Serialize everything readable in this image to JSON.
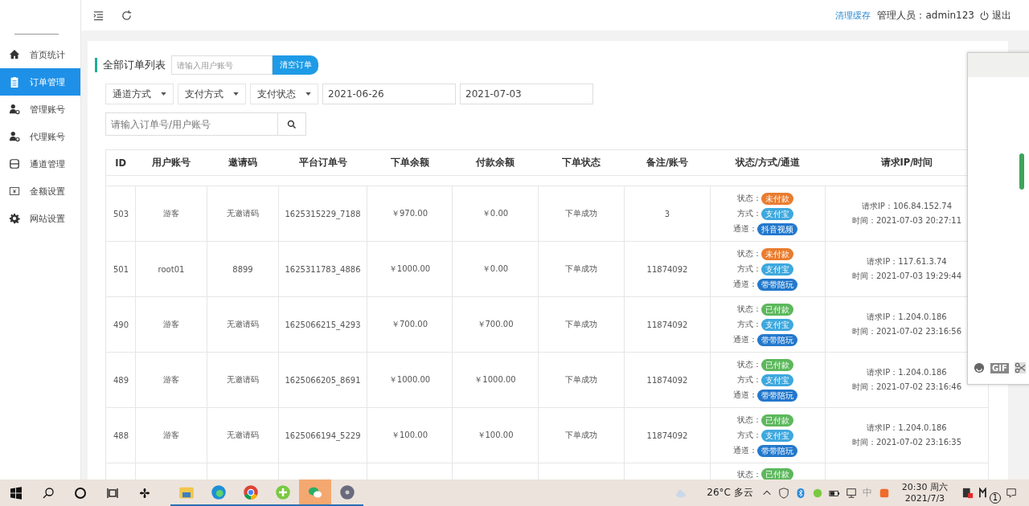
{
  "header": {
    "clear_cache": "清理缓存",
    "admin_label": "管理人员：admin123",
    "logout": "退出"
  },
  "sidebar": {
    "items": [
      {
        "label": "首页统计",
        "selected": false
      },
      {
        "label": "订单管理",
        "selected": true
      },
      {
        "label": "管理账号",
        "selected": false
      },
      {
        "label": "代理账号",
        "selected": false
      },
      {
        "label": "通道管理",
        "selected": false
      },
      {
        "label": "金额设置",
        "selected": false
      },
      {
        "label": "网站设置",
        "selected": false
      }
    ]
  },
  "panel": {
    "title": "全部订单列表",
    "user_search": {
      "placeholder": "请输入用户账号"
    },
    "clear_button": "清空订单",
    "filters": [
      {
        "label": "通道方式"
      },
      {
        "label": "支付方式"
      },
      {
        "label": "支付状态"
      }
    ],
    "date_from": "2021-06-26",
    "date_to": "2021-07-03",
    "search": {
      "placeholder": "请输入订单号/用户账号"
    }
  },
  "table": {
    "columns": [
      "ID",
      "用户账号",
      "邀请码",
      "平台订单号",
      "下单余额",
      "付款余额",
      "下单状态",
      "备注/账号",
      "状态/方式/通道",
      "请求IP/时间"
    ],
    "rows": [
      {
        "cells": [
          "503",
          "游客",
          "无邀请码",
          "1625315229_7188",
          "￥970.00",
          "￥0.00",
          "下单成功",
          "3"
        ],
        "status_label": "状态：",
        "status": {
          "kind": "unpaid",
          "text": "未付款"
        },
        "method_label": "方式：",
        "method": "支付宝",
        "channel_label": "通道：",
        "channel": "抖音视频",
        "ip": "请求IP：106.84.152.74",
        "time": "时间：2021-07-03 20:27:11"
      },
      {
        "cells": [
          "501",
          "root01",
          "8899",
          "1625311783_4886",
          "￥1000.00",
          "￥0.00",
          "下单成功",
          "11874092"
        ],
        "status_label": "状态：",
        "status": {
          "kind": "unpaid",
          "text": "未付款"
        },
        "method_label": "方式：",
        "method": "支付宝",
        "channel_label": "通道：",
        "channel": "带带陪玩",
        "ip": "请求IP：117.61.3.74",
        "time": "时间：2021-07-03 19:29:44"
      },
      {
        "cells": [
          "490",
          "游客",
          "无邀请码",
          "1625066215_4293",
          "￥700.00",
          "￥700.00",
          "下单成功",
          "11874092"
        ],
        "status_label": "状态：",
        "status": {
          "kind": "paid",
          "text": "已付款"
        },
        "method_label": "方式：",
        "method": "支付宝",
        "channel_label": "通道：",
        "channel": "带带陪玩",
        "ip": "请求IP：1.204.0.186",
        "time": "时间：2021-07-02 23:16:56"
      },
      {
        "cells": [
          "489",
          "游客",
          "无邀请码",
          "1625066205_8691",
          "￥1000.00",
          "￥1000.00",
          "下单成功",
          "11874092"
        ],
        "status_label": "状态：",
        "status": {
          "kind": "paid",
          "text": "已付款"
        },
        "method_label": "方式：",
        "method": "支付宝",
        "channel_label": "通道：",
        "channel": "带带陪玩",
        "ip": "请求IP：1.204.0.186",
        "time": "时间：2021-07-02 23:16:46"
      },
      {
        "cells": [
          "488",
          "游客",
          "无邀请码",
          "1625066194_5229",
          "￥100.00",
          "￥100.00",
          "下单成功",
          "11874092"
        ],
        "status_label": "状态：",
        "status": {
          "kind": "paid",
          "text": "已付款"
        },
        "method_label": "方式：",
        "method": "支付宝",
        "channel_label": "通道：",
        "channel": "带带陪玩",
        "ip": "请求IP：1.204.0.186",
        "time": "时间：2021-07-02 23:16:35"
      }
    ],
    "partial_row": {
      "status_label": "状态：",
      "status": {
        "kind": "paid",
        "text": "已付款"
      }
    }
  },
  "chat_panel": {
    "gif": "GIF"
  },
  "taskbar": {
    "weather": "26°C 多云",
    "ime": "中",
    "time": "20:30 周六",
    "date": "2021/7/3",
    "badge": "1"
  }
}
